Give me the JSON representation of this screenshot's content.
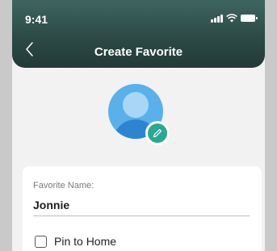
{
  "status_bar": {
    "time": "9:41"
  },
  "header": {
    "title": "Create Favorite",
    "back_icon": "chevron-left-icon"
  },
  "avatar": {
    "icon": "user-avatar-icon",
    "edit_icon": "pencil-icon",
    "badge_color": "#2aa892"
  },
  "form": {
    "name_label": "Favorite Name:",
    "name_value": "Jonnie",
    "pin_label": "Pin to Home",
    "pin_checked": false
  },
  "colors": {
    "header": "#2c4a46",
    "accent": "#2aa892",
    "avatar": "#5ab0ea"
  }
}
